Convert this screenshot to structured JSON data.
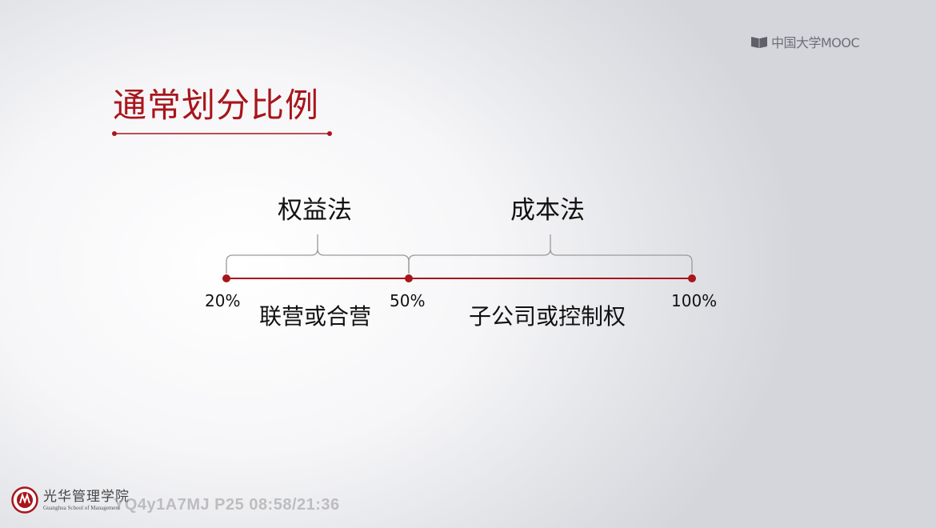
{
  "platform": {
    "name": "中国大学MOOC",
    "icon": "book-icon"
  },
  "slide": {
    "title": "通常划分比例",
    "methods": {
      "equity": "权益法",
      "cost": "成本法"
    },
    "thresholds": {
      "low": "20%",
      "mid": "50%",
      "high": "100%"
    },
    "relations": {
      "joint_venture": "联营或合营",
      "subsidiary": "子公司或控制权"
    }
  },
  "footer": {
    "school_cn": "光华管理学院",
    "school_en": "Guanghua School of Management",
    "video_watermark": "YQ4y1A7MJ P25 08:58/21:36"
  },
  "colors": {
    "accent": "#a8151b",
    "text": "#111111",
    "brace": "#9a9a9a"
  }
}
